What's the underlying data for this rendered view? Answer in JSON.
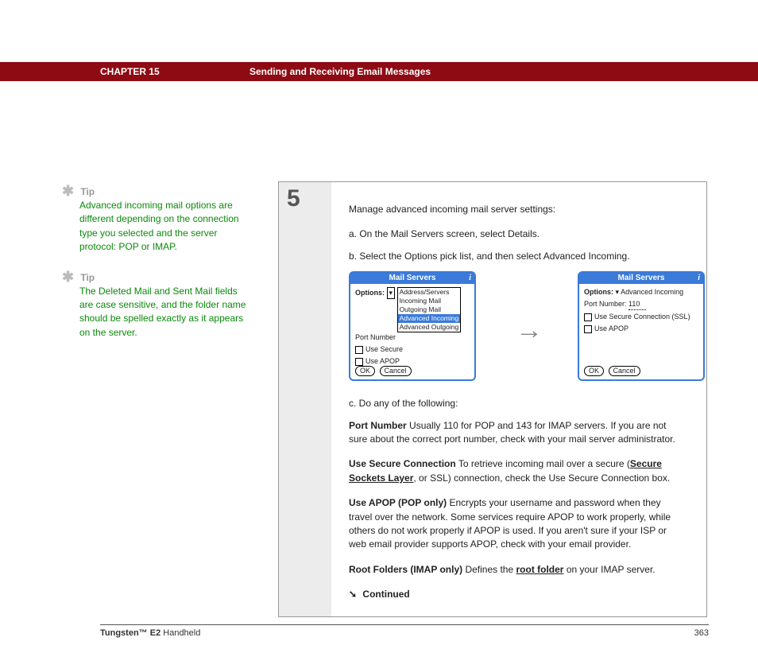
{
  "header": {
    "chapter": "CHAPTER 15",
    "title": "Sending and Receiving Email Messages"
  },
  "tips": [
    {
      "label": "Tip",
      "body": "Advanced incoming mail options are different depending on the connection type you selected and the server protocol: POP or IMAP."
    },
    {
      "label": "Tip",
      "body": "The Deleted Mail and Sent Mail fields are case sensitive, and the folder name should be spelled exactly as it appears on the server."
    }
  ],
  "step": {
    "number": "5",
    "intro": "Manage advanced incoming mail server settings:",
    "a": "On the Mail Servers screen, select Details.",
    "b": "Select the Options pick list, and then select Advanced Incoming.",
    "c": "Do any of the following:"
  },
  "screens": {
    "left": {
      "title": "Mail Servers",
      "options_label": "Options:",
      "port_label": "Port Number",
      "dd_sel": "Address/Servers",
      "dd_items": [
        "Address/Servers",
        "Incoming Mail",
        "Outgoing Mail",
        "Advanced Incoming",
        "Advanced Outgoing"
      ],
      "ssl": "Use Secure",
      "apop": "Use APOP",
      "ok": "OK",
      "cancel": "Cancel"
    },
    "right": {
      "title": "Mail Servers",
      "options_label": "Options:",
      "options_value": "Advanced Incoming",
      "port_label": "Port Number:",
      "port_value": "110",
      "ssl": "Use Secure Connection (SSL)",
      "apop": "Use APOP",
      "ok": "OK",
      "cancel": "Cancel"
    }
  },
  "details": {
    "port_label": "Port Number",
    "port_body": "   Usually 110 for POP and 143 for IMAP servers. If you are not sure about the correct port number, check with your mail server administrator.",
    "ssl_label": "Use Secure Connection",
    "ssl_pre": "   To retrieve incoming mail over a secure (",
    "ssl_link": "Secure Sockets Layer",
    "ssl_post": ", or SSL) connection, check the Use Secure Connection box.",
    "apop_label": "Use APOP (POP only)",
    "apop_body": "   Encrypts your username and password when they travel over the network. Some services require APOP to work properly, while others do not work properly if APOP is used. If you aren't sure if your ISP or web email provider supports APOP, check with your email provider.",
    "root_label": "Root Folders (IMAP only)",
    "root_pre": "   Defines the ",
    "root_link": "root folder",
    "root_post": " on your IMAP server.",
    "continued": "Continued"
  },
  "footer": {
    "product_bold": "Tungsten™ E2",
    "product_rest": " Handheld",
    "page": "363"
  }
}
